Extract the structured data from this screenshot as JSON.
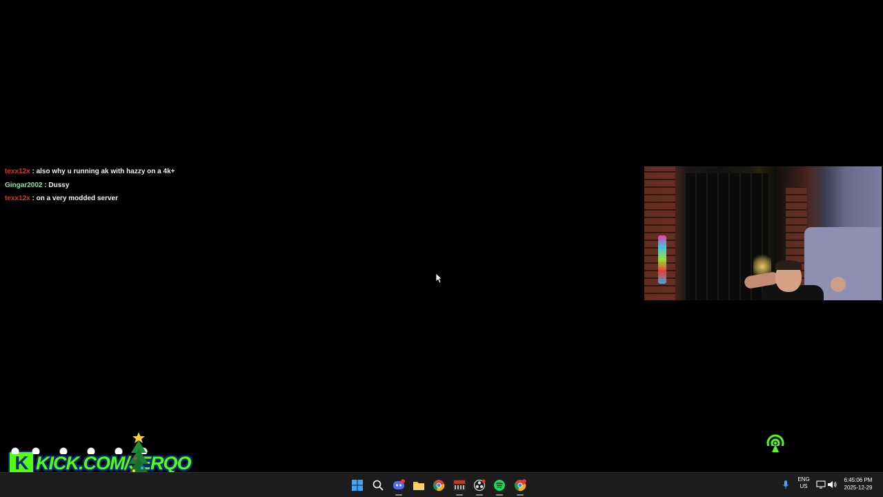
{
  "chat": {
    "messages": [
      {
        "user": "texx12x",
        "separator": " : ",
        "text": "also why u running ak with hazzy on a 4k+",
        "color": "#e0302a"
      },
      {
        "user": "Gingar2002",
        "separator": " : ",
        "text": "Dussy",
        "color": "#8fe0a8"
      },
      {
        "user": "texx12x",
        "separator": " : ",
        "text": "on a very modded server",
        "color": "#e0302a"
      }
    ]
  },
  "overlay": {
    "kick_banner": "KICK.COM/JERQO",
    "kick_badge": "K",
    "accent": "#53fc18"
  },
  "webcam": {
    "icon": "webcam-feed"
  },
  "taskbar": {
    "apps": [
      {
        "name": "start-menu-icon"
      },
      {
        "name": "search-icon"
      },
      {
        "name": "discord-icon"
      },
      {
        "name": "file-explorer-icon"
      },
      {
        "name": "chrome-icon"
      },
      {
        "name": "voicemeeter-icon"
      },
      {
        "name": "obs-icon"
      },
      {
        "name": "spotify-icon"
      },
      {
        "name": "chrome-profile-icon"
      }
    ],
    "tray": {
      "lang_line1": "ENG",
      "lang_line2": "US",
      "time": "6:45:06 PM",
      "date": "2025-12-29"
    }
  }
}
